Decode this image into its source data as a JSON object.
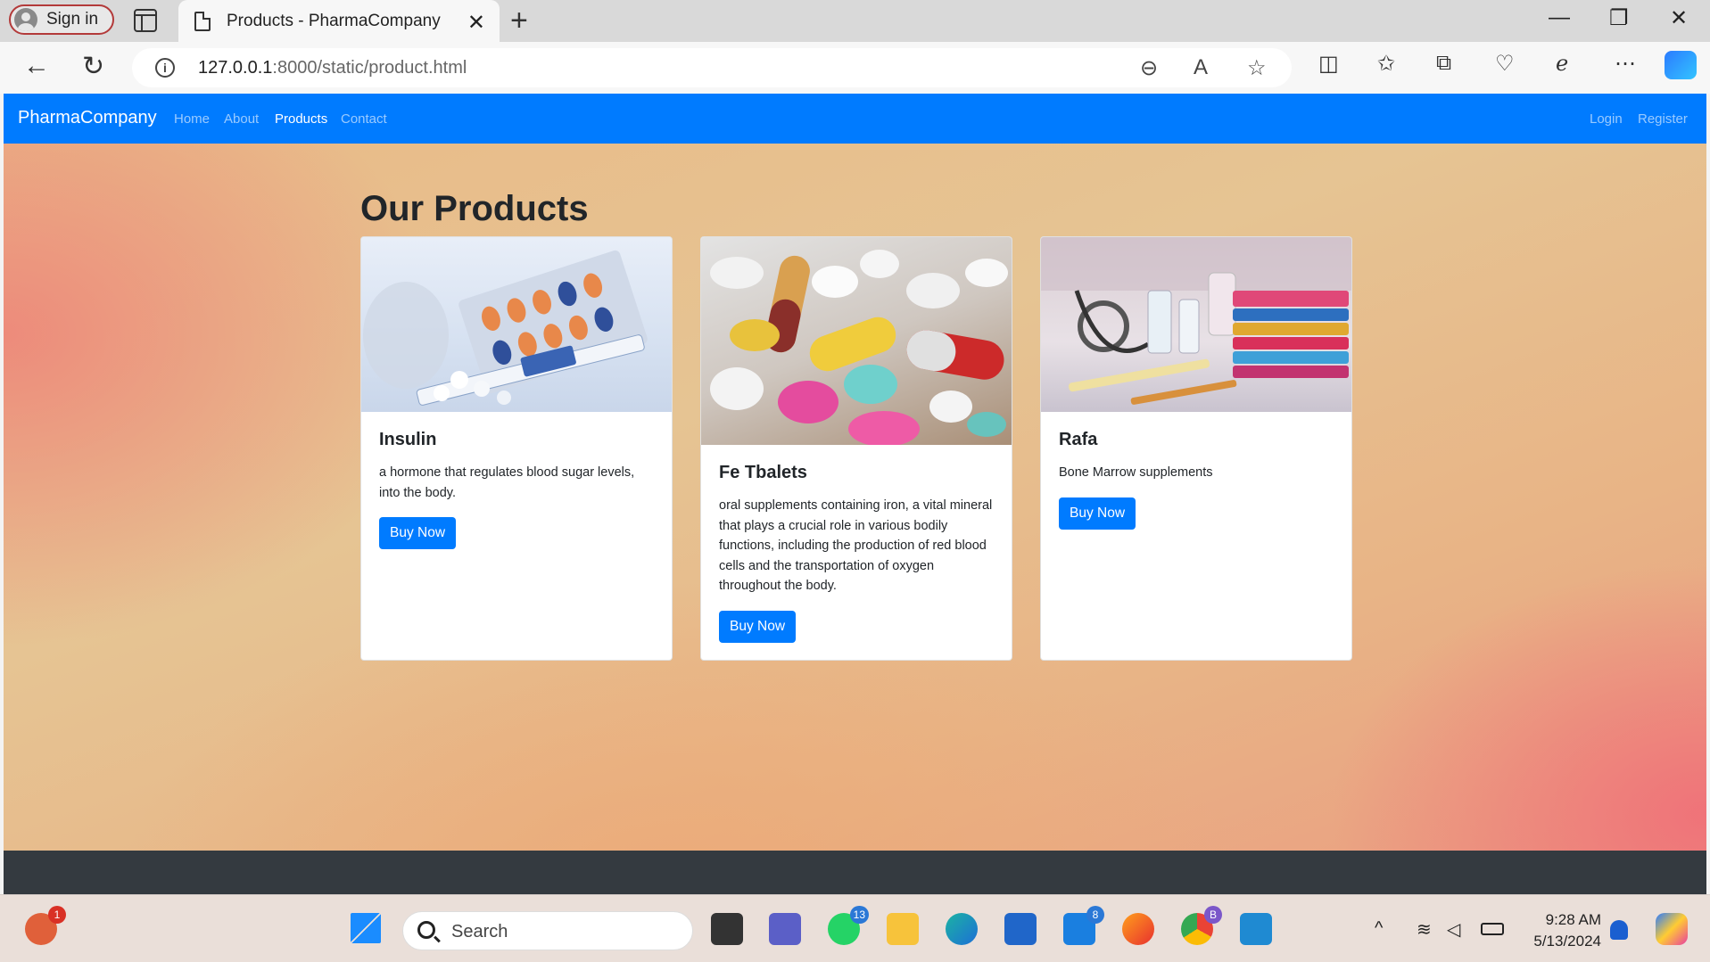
{
  "browser": {
    "signin_label": "Sign in",
    "tab_title": "Products - PharmaCompany",
    "url_host": "127.0.0.1",
    "url_rest": ":8000/static/product.html"
  },
  "site": {
    "brand": "PharmaCompany",
    "nav": [
      "Home",
      "About",
      "Products",
      "Contact"
    ],
    "active_nav": "Products",
    "login": "Login",
    "register": "Register",
    "heading": "Our Products",
    "accent_color": "#007bff",
    "footer_color": "#343a40"
  },
  "products": [
    {
      "title": "Insulin",
      "description": "a hormone that regulates blood sugar levels, into the body.",
      "button": "Buy Now"
    },
    {
      "title": "Fe Tbalets",
      "description": "oral supplements containing iron, a vital mineral that plays a crucial role in various bodily functions, including the production of red blood cells and the transportation of oxygen throughout the body.",
      "button": "Buy Now"
    },
    {
      "title": "Rafa",
      "description": "Bone Marrow supplements",
      "button": "Buy Now"
    }
  ],
  "taskbar": {
    "search_placeholder": "Search",
    "time": "9:28 AM",
    "date": "5/13/2024",
    "badges": {
      "alert": "1",
      "whatsapp": "13",
      "mail": "8",
      "chrome_profile": "B"
    }
  }
}
